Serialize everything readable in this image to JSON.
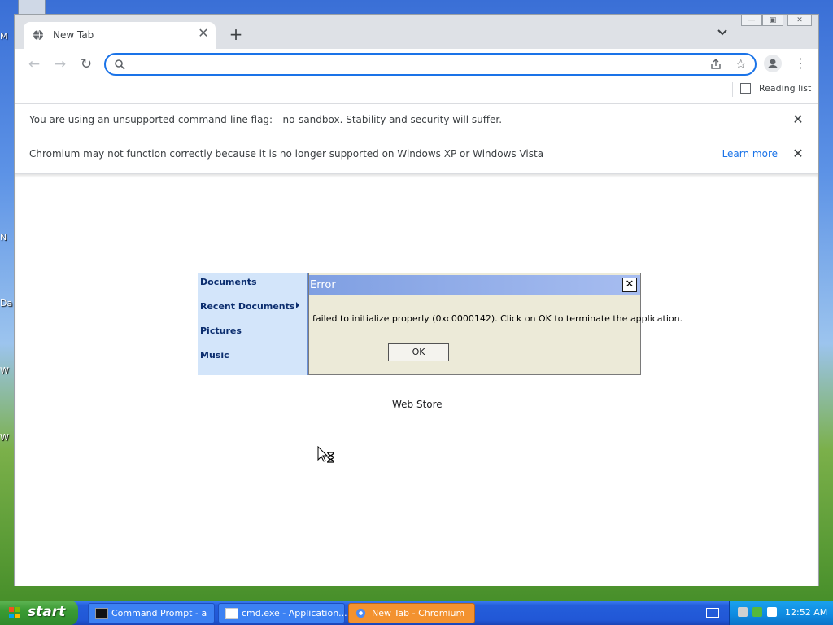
{
  "desktop": {
    "fragments": [
      "M",
      "N",
      "Da",
      "W",
      "W"
    ]
  },
  "browser": {
    "tab": {
      "title": "New Tab",
      "icon": "globe-icon"
    },
    "omnibox": {
      "value": "",
      "placeholder": ""
    },
    "bookmarks": {
      "reading_list": "Reading list"
    },
    "infobars": [
      {
        "message": "You are using an unsupported command-line flag: --no-sandbox. Stability and security will suffer.",
        "link": ""
      },
      {
        "message": "Chromium may not function correctly because it is no longer supported on Windows XP or Windows Vista",
        "link": "Learn more"
      }
    ],
    "content": {
      "shortcut_label": "Web Store"
    }
  },
  "start_menu": {
    "items": [
      "Documents",
      "Recent Documents",
      "Pictures",
      "Music"
    ]
  },
  "dialog": {
    "title": "Error",
    "message": "failed to initialize properly (0xc0000142). Click on OK to terminate the application.",
    "ok_label": "OK",
    "close_label": "✕"
  },
  "taskbar": {
    "start_label": "start",
    "tasks": [
      {
        "label": "Command Prompt - a",
        "active": false
      },
      {
        "label": "cmd.exe - Application...",
        "active": false
      },
      {
        "label": "New Tab - Chromium",
        "active": true
      }
    ],
    "clock": "12:52 AM"
  },
  "colors": {
    "accent": "#1a73e8",
    "taskbar_blue": "#245edb",
    "active_task": "#f3922f",
    "dialog_bg": "#ecead8",
    "start_green": "#3a9b33"
  }
}
